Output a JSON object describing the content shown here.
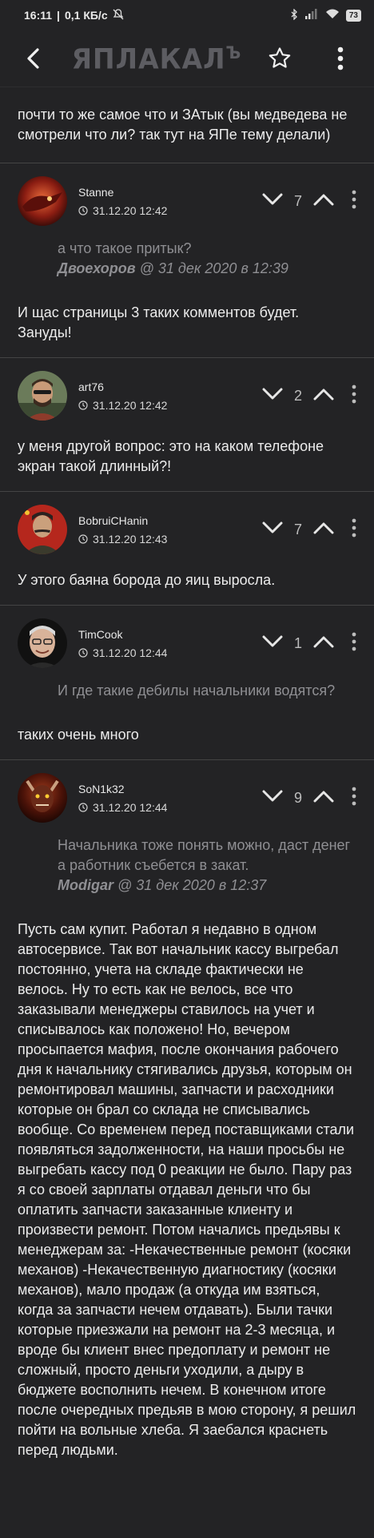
{
  "status": {
    "time": "16:11",
    "speed": "0,1 КБ/с",
    "battery": "73"
  },
  "header": {
    "logo": "ЯПЛАКАЛ",
    "logo_sup": "ъ"
  },
  "top_text": "почти то же самое что и ЗАтык (вы медведева не смотрели что ли? так тут на ЯПе тему делали)",
  "comments": [
    {
      "author": "Stanne",
      "date": "31.12.20 12:42",
      "votes": "7",
      "quote_text": "а что такое притык?",
      "quote_author": "Двоехоров",
      "quote_date": "@ 31 дек 2020 в 12:39",
      "body": "И щас страницы 3 таких комментов будет. Зануды!"
    },
    {
      "author": "art76",
      "date": "31.12.20 12:42",
      "votes": "2",
      "body": "у меня другой вопрос: это на каком телефоне экран такой длинный?!"
    },
    {
      "author": "BobruiCHanin",
      "date": "31.12.20 12:43",
      "votes": "7",
      "body": "У этого баяна борода до яиц выросла."
    },
    {
      "author": "TimCook",
      "date": "31.12.20 12:44",
      "votes": "1",
      "quote_text": "И где такие дебилы начальники водятся?",
      "body": "таких очень много"
    },
    {
      "author": "SoN1k32",
      "date": "31.12.20 12:44",
      "votes": "9",
      "quote_text": "Начальника тоже понять можно, даст денег а работник съебется в закат.",
      "quote_author": "Modigar",
      "quote_date": "@ 31 дек 2020 в 12:37",
      "body": "Пусть сам купит. Работал я недавно в одном автосервисе. Так вот начальник кассу выгребал постоянно, учета на складе фактически не велось. Ну то есть как не велось, все что заказывали менеджеры ставилось на учет и списывалось как положено! Но, вечером просыпается мафия, после окончания рабочего дня к начальнику стягивались друзья, которым он ремонтировал машины, запчасти и расходники которые он брал со склада не списывались вообще. Со временем перед поставщиками стали появляться задолженности, на наши просьбы не выгребать кассу под 0 реакции не было. Пару раз я со своей зарплаты отдавал деньги что бы оплатить запчасти заказанные клиенту и произвести ремонт. Потом начались предьявы к менеджерам за: -Некачественные ремонт (косяки механов) -Некачественную диагностику (косяки механов), мало продаж (а откуда им взяться, когда за запчасти нечем отдавать). Были тачки которые приезжали на ремонт на 2-3 месяца, и вроде бы клиент внес предоплату и ремонт не сложный, просто деньги уходили, а дыру в бюджете восполнить нечем. В конечном итоге после очередных предьяв в мою сторону, я решил пойти на вольные хлеба. Я заебался краснеть перед людьми."
    }
  ]
}
